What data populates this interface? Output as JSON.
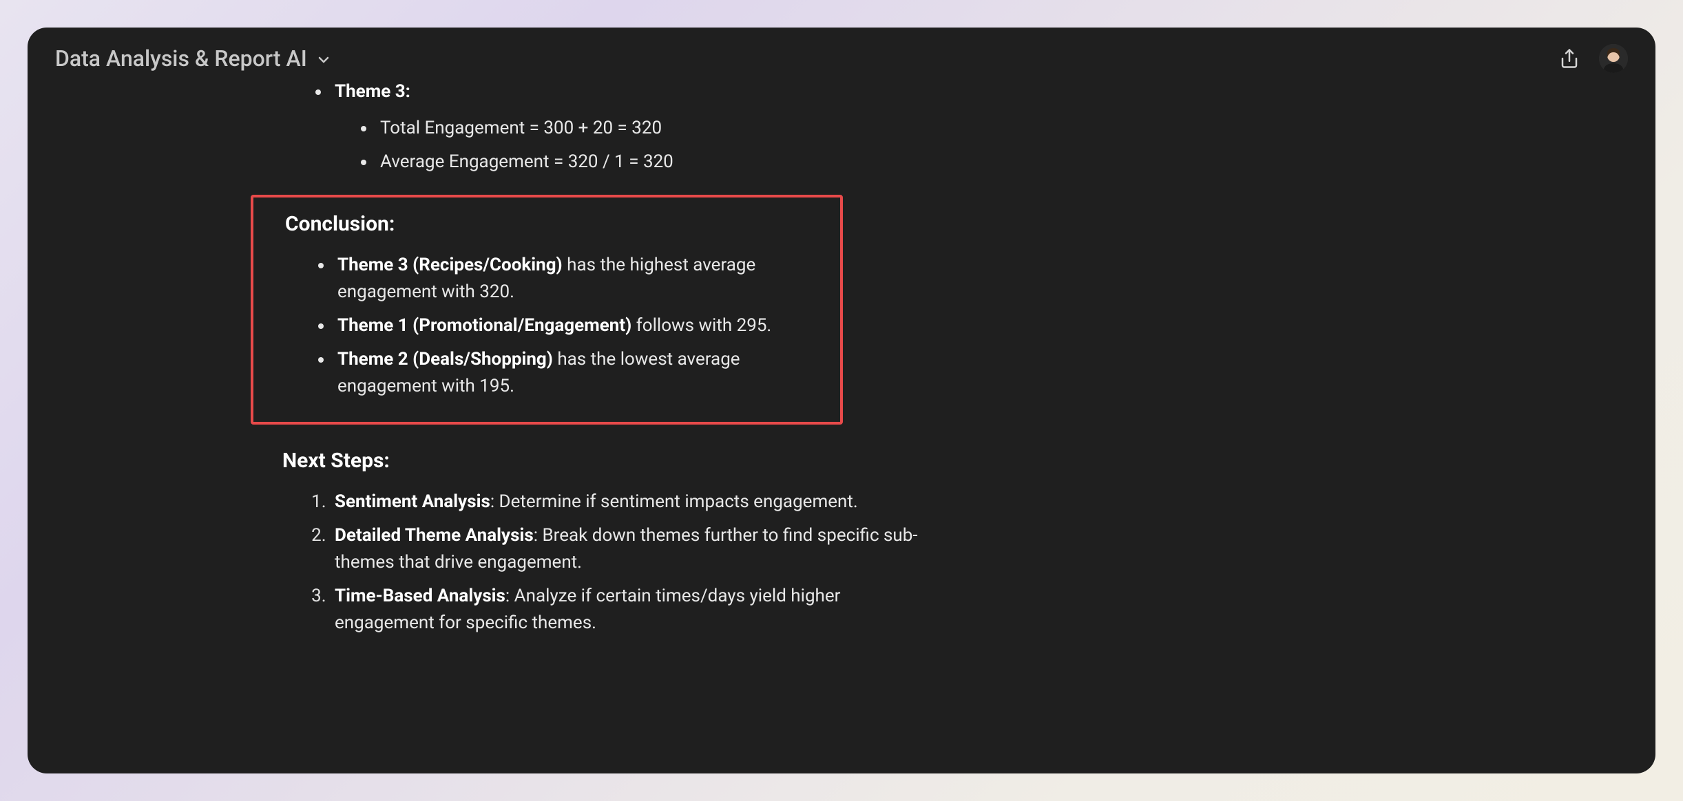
{
  "header": {
    "title": "Data Analysis & Report AI"
  },
  "theme3": {
    "label": "Theme 3",
    "total": "Total Engagement = 300 + 20 = 320",
    "avg": "Average Engagement = 320 / 1 = 320"
  },
  "conclusion": {
    "heading": "Conclusion:",
    "items": [
      {
        "bold": "Theme 3 (Recipes/Cooking)",
        "rest": " has the highest average engagement with 320."
      },
      {
        "bold": "Theme 1 (Promotional/Engagement)",
        "rest": " follows with 295."
      },
      {
        "bold": "Theme 2 (Deals/Shopping)",
        "rest": " has the lowest average engagement with 195."
      }
    ]
  },
  "next_steps": {
    "heading": "Next Steps:",
    "items": [
      {
        "bold": "Sentiment Analysis",
        "rest": ": Determine if sentiment impacts engagement."
      },
      {
        "bold": "Detailed Theme Analysis",
        "rest": ": Break down themes further to find specific sub-themes that drive engagement."
      },
      {
        "bold": "Time-Based Analysis",
        "rest": ": Analyze if certain times/days yield higher engagement for specific themes."
      }
    ]
  }
}
